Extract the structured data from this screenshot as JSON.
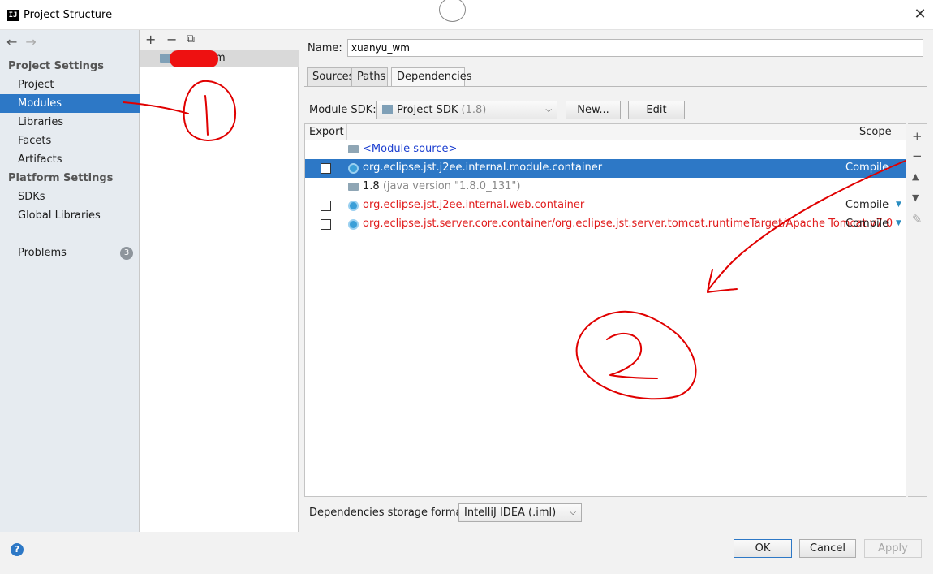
{
  "window": {
    "title": "Project Structure",
    "close_glyph": "✕",
    "app_icon_text": "IJ"
  },
  "nav": {
    "back_glyph": "←",
    "forward_glyph": "→",
    "project_settings_header": "Project Settings",
    "project_settings_items": [
      "Project",
      "Modules",
      "Libraries",
      "Facets",
      "Artifacts"
    ],
    "platform_settings_header": "Platform Settings",
    "platform_settings_items": [
      "SDKs",
      "Global Libraries"
    ],
    "problems_label": "Problems",
    "problems_count": "3",
    "selected": "Modules"
  },
  "modules_list": {
    "add_glyph": "+",
    "remove_glyph": "−",
    "copy_glyph": "⧉",
    "visible_suffix": "m"
  },
  "module": {
    "name_label": "Name:",
    "name_value": "xuanyu_wm",
    "tabs": [
      "Sources",
      "Paths",
      "Dependencies"
    ],
    "active_tab": "Dependencies",
    "sdk_label": "Module SDK:",
    "sdk_value": "Project SDK",
    "sdk_version": "(1.8)",
    "new_button": "New...",
    "edit_button": "Edit"
  },
  "dependencies": {
    "col_export": "Export",
    "col_scope": "Scope",
    "rows": [
      {
        "text": "<Module source>",
        "scope": "",
        "checkbox": false
      },
      {
        "text": "org.eclipse.jst.j2ee.internal.module.container",
        "scope": "Compile",
        "checkbox": true
      },
      {
        "text": "1.8",
        "text_suffix": "(java version \"1.8.0_131\")",
        "scope": "",
        "checkbox": false
      },
      {
        "text": "org.eclipse.jst.j2ee.internal.web.container",
        "scope": "Compile",
        "checkbox": true
      },
      {
        "text": "org.eclipse.jst.server.core.container/org.eclipse.jst.server.tomcat.runtimeTarget/Apache Tomcat v7.0",
        "scope": "Compile",
        "checkbox": true
      }
    ],
    "side_tools": [
      "+",
      "−",
      "▲",
      "▼",
      "✎"
    ],
    "storage_label": "Dependencies storage format:",
    "storage_value": "IntelliJ IDEA (.iml)"
  },
  "footer": {
    "help": "?",
    "ok": "OK",
    "cancel": "Cancel",
    "apply": "Apply"
  },
  "colors": {
    "selection": "#2d78c6",
    "error_red": "#e01c1c",
    "module_source_blue": "#1c3fd0",
    "annotation_red": "#e00000"
  }
}
